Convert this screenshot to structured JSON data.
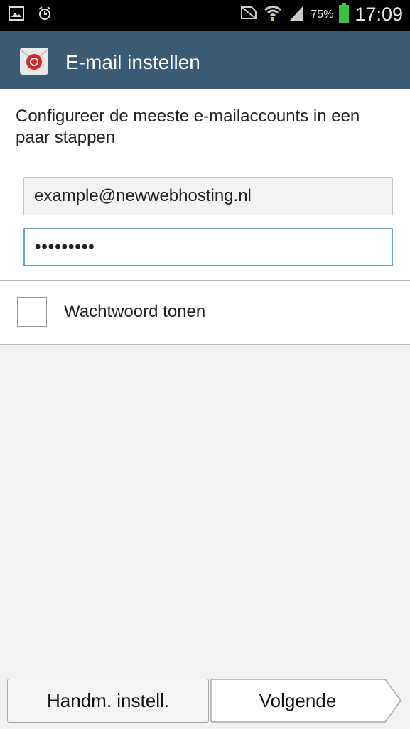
{
  "status_bar": {
    "icons": [
      "gallery-icon",
      "alarm-icon",
      "no-sim-icon",
      "wifi-icon",
      "signal-icon",
      "battery-icon"
    ],
    "battery": "75%",
    "time": "17:09"
  },
  "action_bar": {
    "title": "E-mail instellen",
    "icon": "email-app-icon",
    "color": "#3b5a73"
  },
  "form": {
    "intro": "Configureer de meeste e-mailaccounts in een paar stappen",
    "email_value": "example@newwebhosting.nl",
    "password_value": "•••••••••",
    "show_password_label": "Wachtwoord tonen",
    "show_password_checked": false
  },
  "buttons": {
    "manual": "Handm. instell.",
    "next": "Volgende"
  }
}
